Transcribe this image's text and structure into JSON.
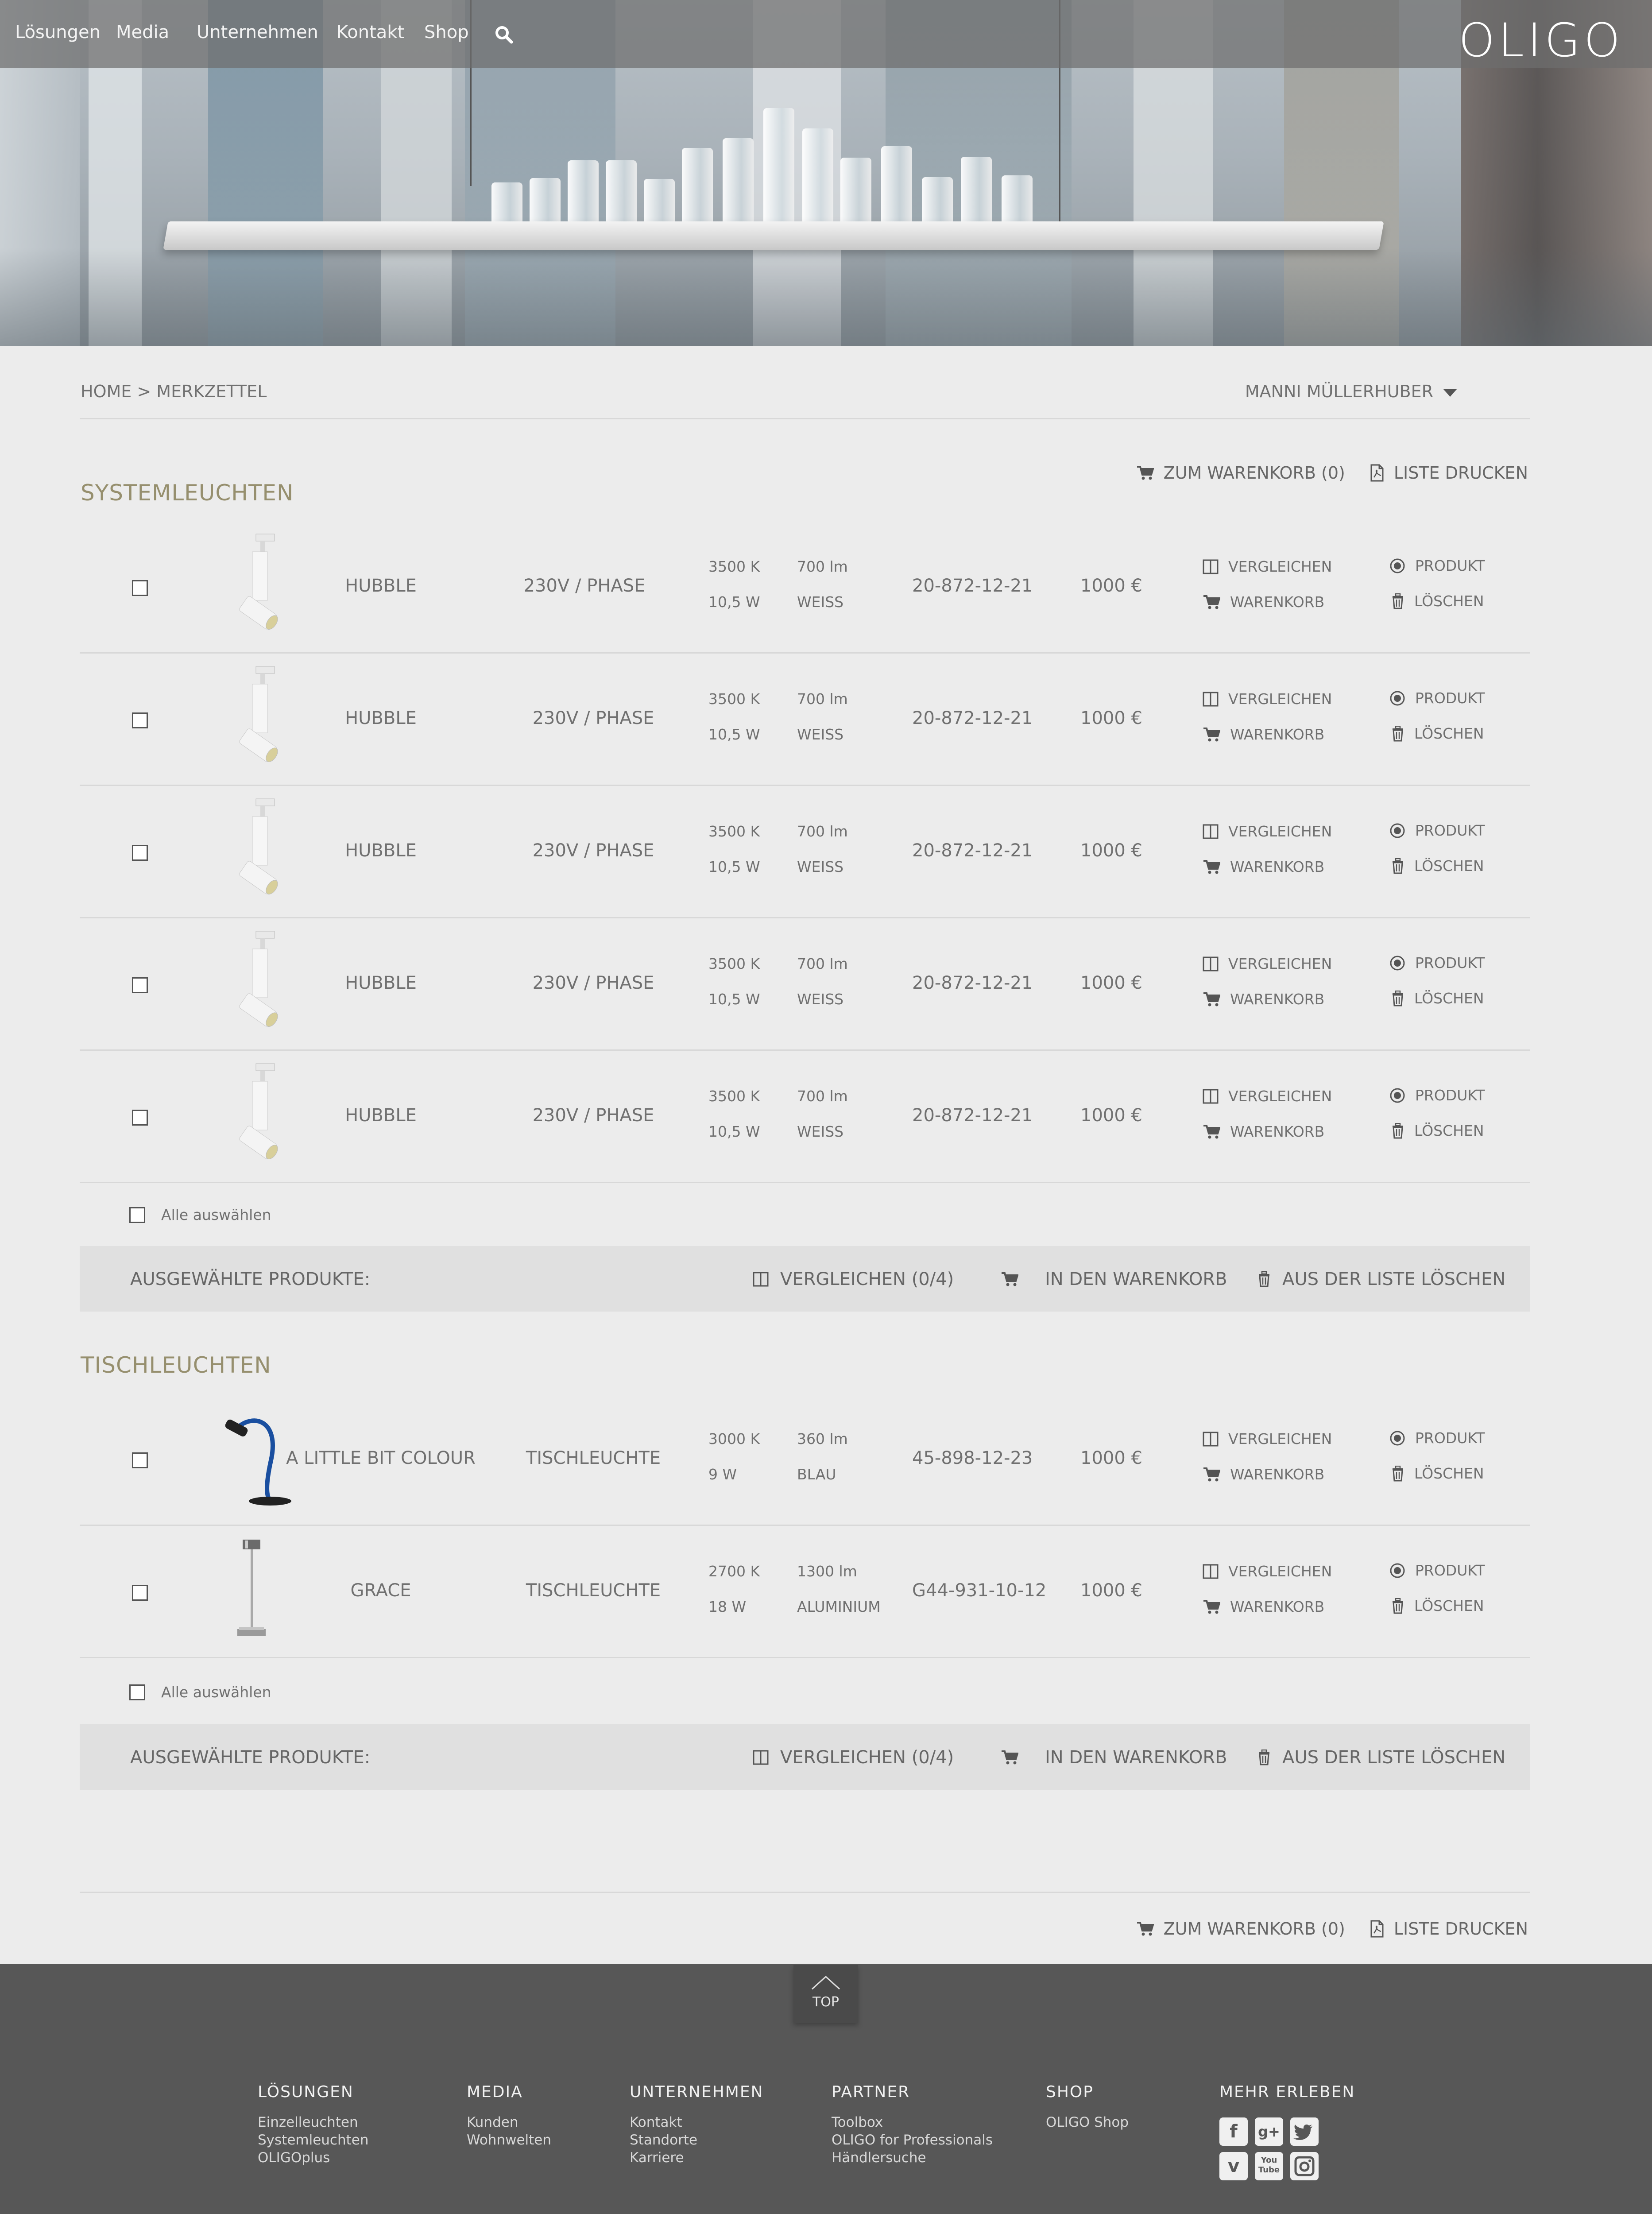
{
  "header": {
    "nav": [
      "Lösungen",
      "Media",
      "Unternehmen",
      "Kontakt",
      "Shop"
    ],
    "logo": "OLIGO"
  },
  "breadcrumb": "HOME > MERKZETTEL",
  "user": "MANNI MÜLLERHUBER",
  "toolbar": {
    "cart": "ZUM WARENKORB (0)",
    "print": "LISTE DRUCKEN"
  },
  "sections": [
    {
      "title": "SYSTEMLEUCHTEN",
      "rows": [
        {
          "name": "HUBBLE",
          "type": "230V / PHASE",
          "k": "3500 K",
          "w": "10,5 W",
          "lm": "700 lm",
          "color": "WEISS",
          "article": "20-872-12-21",
          "price": "1000 €"
        },
        {
          "name": "HUBBLE",
          "type": "230V / PHASE",
          "k": "3500 K",
          "w": "10,5 W",
          "lm": "700 lm",
          "color": "WEISS",
          "article": "20-872-12-21",
          "price": "1000 €"
        },
        {
          "name": "HUBBLE",
          "type": "230V / PHASE",
          "k": "3500 K",
          "w": "10,5 W",
          "lm": "700 lm",
          "color": "WEISS",
          "article": "20-872-12-21",
          "price": "1000 €"
        },
        {
          "name": "HUBBLE",
          "type": "230V / PHASE",
          "k": "3500 K",
          "w": "10,5 W",
          "lm": "700 lm",
          "color": "WEISS",
          "article": "20-872-12-21",
          "price": "1000 €"
        },
        {
          "name": "HUBBLE",
          "type": "230V / PHASE",
          "k": "3500 K",
          "w": "10,5 W",
          "lm": "700 lm",
          "color": "WEISS",
          "article": "20-872-12-21",
          "price": "1000 €"
        }
      ]
    },
    {
      "title": "TISCHLEUCHTEN",
      "rows": [
        {
          "name": "A LITTLE BIT COLOUR",
          "type": "TISCHLEUCHTE",
          "k": "3000 K",
          "w": "9 W",
          "lm": "360 lm",
          "color": "BLAU",
          "article": "45-898-12-23",
          "price": "1000 €"
        },
        {
          "name": "GRACE",
          "type": "TISCHLEUCHTE",
          "k": "2700 K",
          "w": "18 W",
          "lm": "1300 lm",
          "color": "ALUMINIUM",
          "article": "G44-931-10-12",
          "price": "1000 €"
        }
      ]
    }
  ],
  "row_actions": {
    "compare": "VERGLEICHEN",
    "cart": "WARENKORB",
    "product": "PRODUKT",
    "delete": "LÖSCHEN"
  },
  "select_all": "Alle auswählen",
  "bulk": {
    "label": "AUSGEWÄHLTE PRODUKTE:",
    "compare": "VERGLEICHEN (0/4)",
    "cart": "IN DEN WARENKORB",
    "delete": "AUS DER LISTE LÖSCHEN"
  },
  "footer": {
    "top": "TOP",
    "columns": [
      {
        "title": "LÖSUNGEN",
        "links": [
          "Einzelleuchten",
          "Systemleuchten",
          "OLIGOplus"
        ]
      },
      {
        "title": "MEDIA",
        "links": [
          "Kunden",
          "Wohnwelten"
        ]
      },
      {
        "title": "UNTERNEHMEN",
        "links": [
          "Kontakt",
          "Standorte",
          "Karriere"
        ]
      },
      {
        "title": "PARTNER",
        "links": [
          "Toolbox",
          "OLIGO for Professionals",
          "Händlersuche"
        ]
      },
      {
        "title": "SHOP",
        "links": [
          "OLIGO Shop"
        ]
      },
      {
        "title": "MEHR ERLEBEN",
        "links": []
      }
    ],
    "social": [
      "facebook-icon",
      "google-plus-icon",
      "twitter-icon",
      "vimeo-icon",
      "youtube-icon",
      "instagram-icon"
    ],
    "youtube_label": "You Tube"
  },
  "colors": {
    "accent": "#968f6e",
    "footer": "#575757",
    "bulk_bg": "#e0e0e0"
  }
}
